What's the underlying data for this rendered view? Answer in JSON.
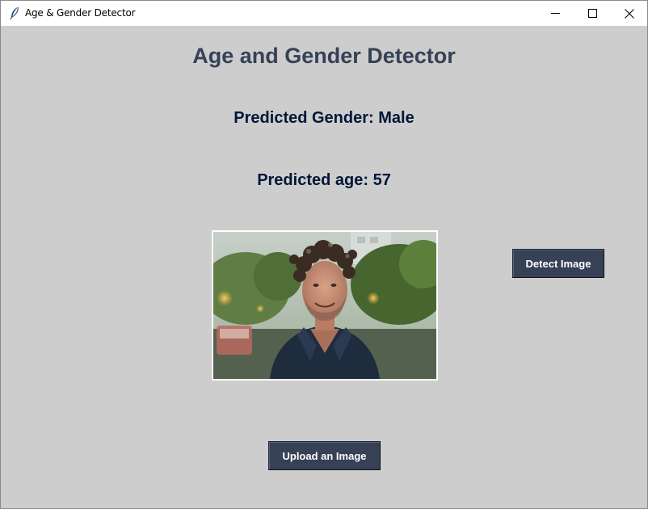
{
  "window": {
    "title": "Age & Gender Detector",
    "icon": "feather-icon"
  },
  "main": {
    "heading": "Age and Gender Detector",
    "gender_label": "Predicted Gender: Male",
    "age_label": "Predicted age: 57"
  },
  "buttons": {
    "detect_label": "Detect Image",
    "upload_label": "Upload an Image"
  },
  "colors": {
    "background": "#cdcdcd",
    "heading": "#364156",
    "result_text": "#011638",
    "button_bg": "#364156",
    "button_text": "#ffffff"
  }
}
